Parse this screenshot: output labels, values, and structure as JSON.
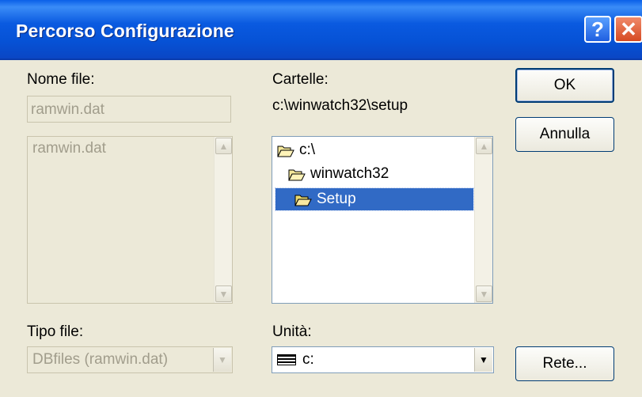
{
  "window": {
    "title": "Percorso Configurazione",
    "help_glyph": "?",
    "close_glyph": "✕"
  },
  "left": {
    "file_name_label": "Nome file:",
    "file_name_value": "ramwin.dat",
    "file_list": [
      "ramwin.dat"
    ],
    "file_type_label": "Tipo file:",
    "file_type_value": "DBfiles (ramwin.dat)"
  },
  "right": {
    "folders_label": "Cartelle:",
    "current_path": "c:\\winwatch32\\setup",
    "folders": [
      {
        "label": "c:\\",
        "selected": false
      },
      {
        "label": "winwatch32",
        "selected": false
      },
      {
        "label": "Setup",
        "selected": true
      }
    ],
    "drive_label": "Unità:",
    "drive_value": "c:"
  },
  "buttons": {
    "ok": "OK",
    "cancel": "Annulla",
    "network": "Rete..."
  },
  "colors": {
    "selection": "#316ac5",
    "titlebar": "#0a5ae0",
    "dialog_bg": "#ece9d8"
  }
}
